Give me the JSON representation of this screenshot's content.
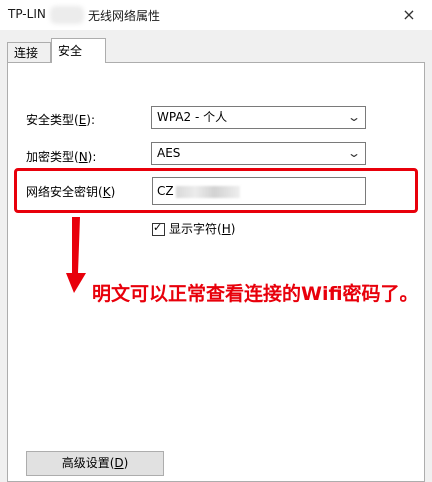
{
  "window": {
    "title_prefix": "TP-LIN",
    "title_main": "无线网络属性",
    "close_label": "×"
  },
  "tabs": [
    {
      "label": "连接",
      "active": false
    },
    {
      "label": "安全",
      "active": true
    }
  ],
  "security": {
    "type_label": "安全类型(",
    "type_key": "E",
    "type_suffix": "):",
    "type_value": "WPA2 - 个人",
    "encryption_label": "加密类型(",
    "encryption_key": "N",
    "encryption_suffix": "):",
    "encryption_value": "AES",
    "key_label": "网络安全密钥(",
    "key_key": "K",
    "key_suffix": ")",
    "key_value": "CZ",
    "show_chars_label": "显示字符(",
    "show_chars_key": "H",
    "show_chars_suffix": ")",
    "show_chars_checked": true
  },
  "annotation": {
    "text": "明文可以正常查看连接的Wifi密码了。",
    "color": "#e8000b"
  },
  "buttons": {
    "advanced_label": "高级设置(",
    "advanced_key": "D",
    "advanced_suffix": ")"
  },
  "icons": {
    "dropdown": "chevron-down-icon",
    "close": "close-icon",
    "check": "checkmark-icon",
    "arrow": "red-arrow-down-icon"
  }
}
